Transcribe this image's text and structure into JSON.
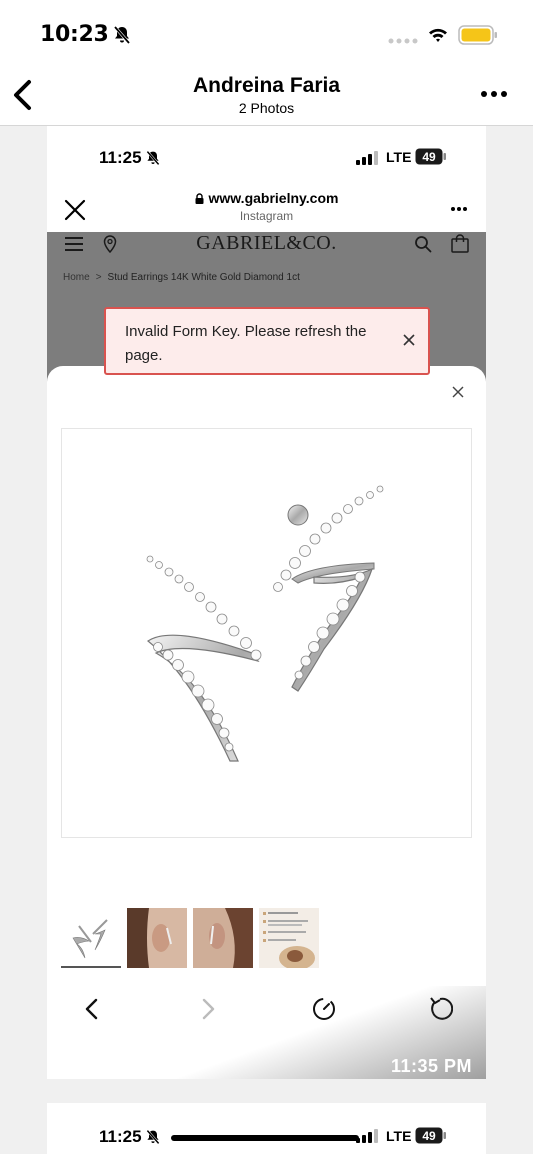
{
  "os_status": {
    "time": "10:23"
  },
  "nav": {
    "title": "Andreina Faria",
    "subtitle": "2 Photos"
  },
  "screenshot": {
    "status": {
      "time": "11:25",
      "network": "LTE",
      "battery": "49"
    },
    "browser": {
      "url": "www.gabrielny.com",
      "source_app": "Instagram"
    },
    "site": {
      "logo": "GABRIEL&CO.",
      "breadcrumb": {
        "home": "Home",
        "separator": ">",
        "current": "Stud Earrings 14K White Gold Diamond 1ct"
      }
    },
    "toast": {
      "message": "Invalid Form Key. Please refresh the page."
    },
    "thumbnails": [
      {
        "name": "earring-product-thumb",
        "active": true
      },
      {
        "name": "ear-model-thumb-1",
        "active": false
      },
      {
        "name": "ear-model-thumb-2",
        "active": false
      },
      {
        "name": "info-card-thumb",
        "active": false
      }
    ],
    "stamp_time": "11:35 PM"
  },
  "screenshot2": {
    "status": {
      "time": "11:25",
      "network": "LTE",
      "battery": "49"
    }
  },
  "colors": {
    "toast_border": "#d9534f",
    "toast_bg": "#fdeceb",
    "site_overlay": "#7d7d7d",
    "battery_fill": "#f5c518"
  }
}
